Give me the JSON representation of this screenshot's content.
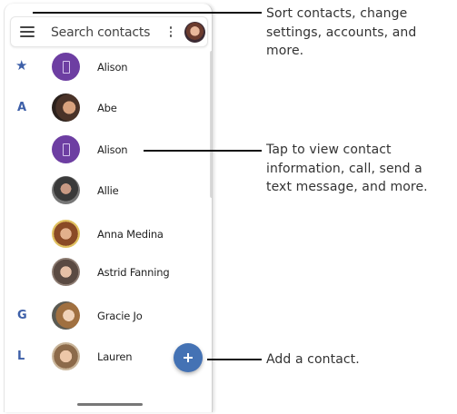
{
  "search": {
    "label": "Search contacts"
  },
  "icons": {
    "menu": "hamburger-menu-icon",
    "more": "more-vert-icon",
    "favorite": "star-icon",
    "add": "plus-icon"
  },
  "colors": {
    "accent": "#3d5fa8",
    "fab": "#4472b4",
    "placeholder_avatar": "#6d3ea2"
  },
  "contacts": [
    {
      "section": "★",
      "name": "Alison"
    },
    {
      "section": "A",
      "name": "Abe"
    },
    {
      "section": "",
      "name": "Alison"
    },
    {
      "section": "",
      "name": "Allie"
    },
    {
      "section": "",
      "name": "Anna Medina"
    },
    {
      "section": "",
      "name": "Astrid Fanning"
    },
    {
      "section": "G",
      "name": "Gracie Jo"
    },
    {
      "section": "L",
      "name": "Lauren"
    }
  ],
  "callouts": {
    "menu": [
      "Sort contacts, change",
      "settings, accounts, and more."
    ],
    "contact": [
      "Tap to view contact",
      "information, call, send a",
      "text message, and more."
    ],
    "add": [
      "Add a contact."
    ]
  }
}
